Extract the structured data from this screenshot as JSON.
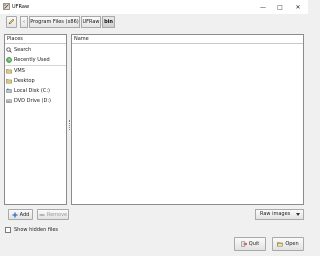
{
  "window": {
    "title": "UFRaw",
    "controls": {
      "minimize": "—",
      "maximize": "□",
      "close": "✕"
    }
  },
  "pathbar": {
    "crumbs": [
      "Program Files (x86)",
      "UFRaw",
      "bin"
    ],
    "active_index": 2
  },
  "places": {
    "header": "Places",
    "items": [
      {
        "label": "Search",
        "icon": "search-icon"
      },
      {
        "label": "Recently Used",
        "icon": "recent-icon"
      },
      {
        "label": "VMS",
        "icon": "folder-icon"
      },
      {
        "label": "Desktop",
        "icon": "desktop-folder-icon"
      },
      {
        "label": "Local Disk (C:)",
        "icon": "drive-icon"
      },
      {
        "label": "DVD Drive (D:)",
        "icon": "dvd-drive-icon"
      }
    ]
  },
  "files": {
    "header": "Name",
    "rows": []
  },
  "actions": {
    "add": "Add",
    "remove": "Remove"
  },
  "filter": {
    "selected": "Raw images"
  },
  "options": {
    "show_hidden": "Show hidden files",
    "show_hidden_checked": false
  },
  "buttons": {
    "quit": "Quit",
    "open": "Open"
  },
  "colors": {
    "accent_green": "#3a9a3a",
    "quit_red": "#c0302a",
    "add_blue": "#2f6fc0"
  }
}
